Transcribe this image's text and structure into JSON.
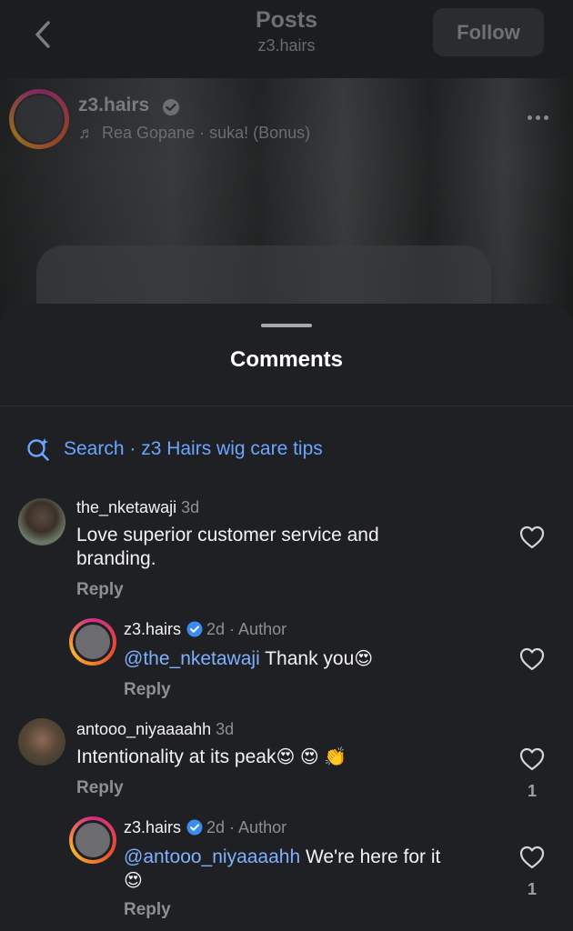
{
  "topbar": {
    "title": "Posts",
    "subtitle": "z3.hairs",
    "follow_label": "Follow"
  },
  "post": {
    "username": "z3.hairs",
    "music": "Rea Gopane · suka! (Bonus)"
  },
  "comments_sheet": {
    "title": "Comments",
    "search_label": "Search · z3 Hairs wig care tips",
    "comments": [
      {
        "username": "the_nketawaji",
        "time": "3d",
        "text": "Love superior customer service and branding.",
        "reply_label": "Reply"
      },
      {
        "username": "z3.hairs",
        "meta": "2d · Author",
        "mention": "@the_nketawaji",
        "text": " Thank you",
        "emoji": "😍",
        "reply_label": "Reply"
      },
      {
        "username": "antooo_niyaaaahh",
        "time": "3d",
        "text": "Intentionality at its peak",
        "emoji": "😍 😍 👏",
        "reply_label": "Reply",
        "likes": "1"
      },
      {
        "username": "z3.hairs",
        "meta": "2d · Author",
        "mention": "@antooo_niyaaaahh",
        "text": " We're here for it",
        "emoji": "😍",
        "reply_label": "Reply",
        "likes": "1"
      }
    ]
  },
  "colors": {
    "accent_link": "#6aa5ff",
    "verified": "#3b8cf0",
    "background": "#1f2024"
  },
  "icons": [
    "back-chevron-icon",
    "verified-icon",
    "music-note-icon",
    "more-icon",
    "search-sparkle-icon",
    "heart-icon"
  ]
}
